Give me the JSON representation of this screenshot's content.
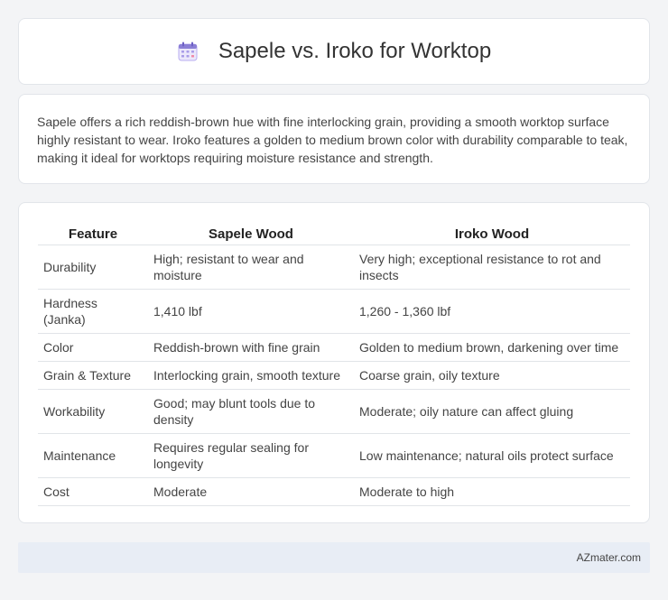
{
  "header": {
    "title": "Sapele vs. Iroko for Worktop",
    "icon": "calendar-icon"
  },
  "description": "Sapele offers a rich reddish-brown hue with fine interlocking grain, providing a smooth worktop surface highly resistant to wear. Iroko features a golden to medium brown color with durability comparable to teak, making it ideal for worktops requiring moisture resistance and strength.",
  "table": {
    "headers": [
      "Feature",
      "Sapele Wood",
      "Iroko Wood"
    ],
    "rows": [
      [
        "Durability",
        "High; resistant to wear and moisture",
        "Very high; exceptional resistance to rot and insects"
      ],
      [
        "Hardness (Janka)",
        "1,410 lbf",
        "1,260 - 1,360 lbf"
      ],
      [
        "Color",
        "Reddish-brown with fine grain",
        "Golden to medium brown, darkening over time"
      ],
      [
        "Grain & Texture",
        "Interlocking grain, smooth texture",
        "Coarse grain, oily texture"
      ],
      [
        "Workability",
        "Good; may blunt tools due to density",
        "Moderate; oily nature can affect gluing"
      ],
      [
        "Maintenance",
        "Requires regular sealing for longevity",
        "Low maintenance; natural oils protect surface"
      ],
      [
        "Cost",
        "Moderate",
        "Moderate to high"
      ]
    ]
  },
  "footer": {
    "text": "AZmater.com"
  },
  "colors": {
    "page_background": "#f3f4f6",
    "card_background": "#ffffff",
    "footer_background": "#e8edf5",
    "icon_accent": "#8b7fd6"
  }
}
